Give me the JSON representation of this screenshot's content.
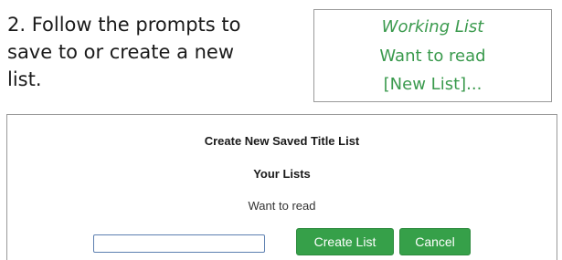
{
  "instruction": {
    "line1": "2. Follow the prompts to",
    "line2": "save to or create a new",
    "line3": "list."
  },
  "list_menu": {
    "items": [
      {
        "label": "Working List"
      },
      {
        "label": "Want to read"
      },
      {
        "label": "[New List]..."
      }
    ]
  },
  "dialog": {
    "title": "Create New Saved Title List",
    "subheading": "Your Lists",
    "existing_lists": [
      "Want to read"
    ],
    "input_value": "",
    "create_label": "Create List",
    "cancel_label": "Cancel"
  },
  "colors": {
    "accent_green": "#36a049",
    "menu_text_green": "#3a9a4d"
  }
}
